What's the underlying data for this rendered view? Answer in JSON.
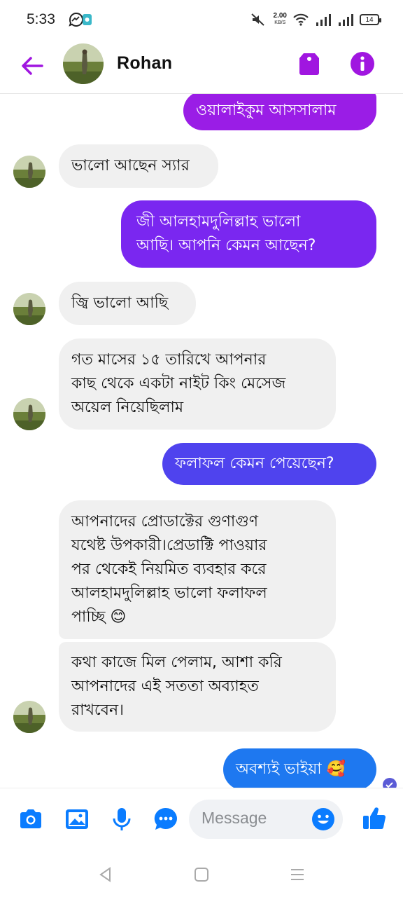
{
  "status_bar": {
    "time": "5:33",
    "net_speed_value": "2.00",
    "net_speed_unit": "KB/S",
    "battery": "14",
    "icons": [
      "messenger-notification-icon",
      "mute-icon",
      "wifi-icon",
      "signal-icon",
      "signal-icon",
      "battery-icon"
    ]
  },
  "header": {
    "contact_name": "Rohan",
    "icons": [
      "back-arrow-icon",
      "avatar",
      "tag-icon",
      "info-icon"
    ]
  },
  "colors": {
    "accent": "#a016e0",
    "bubble_incoming": "#f0f0f0",
    "bubble_out_top": "#9a1de6",
    "bubble_out_mid": "#7a27f0",
    "bubble_out_low": "#4f43ee",
    "bubble_out_bottom": "#1e78f0",
    "composer_icons": "#0a7cff"
  },
  "messages": [
    {
      "side": "out",
      "text": "ওয়ালাইকুম আসসালাম"
    },
    {
      "side": "in",
      "text": "ভালো আছেন স্যার"
    },
    {
      "side": "out",
      "text": "জী আলহামদুলিল্লাহ ভালো\nআছি। আপনি কেমন আছেন?"
    },
    {
      "side": "in",
      "text": "জ্বি ভালো আছি"
    },
    {
      "side": "in",
      "text": "গত মাসের ১৫ তারিখে আপনার\nকাছ থেকে একটা নাইট কিং মেসেজ\nঅয়েল নিয়েছিলাম"
    },
    {
      "side": "out",
      "text": "ফলাফল কেমন পেয়েছেন?"
    },
    {
      "side": "in",
      "text": "আপনাদের প্রোডাক্টের গুণাগুণ\nযথেষ্ট উপকারী।প্রেডাক্টি পাওয়ার\nপর থেকেই নিয়মিত ব্যবহার করে\nআলহামদুলিল্লাহ ভালো ফলাফল\nপাচ্ছি 😊"
    },
    {
      "side": "in",
      "text": "কথা কাজে মিল পেলাম, আশা করি\nআপনাদের এই সততা অব্যাহত\nরাখবেন।"
    },
    {
      "side": "out",
      "text": "অবশ্যই ভাইয়া 🥰"
    }
  ],
  "composer": {
    "placeholder": "Message",
    "icons": [
      "camera-icon",
      "gallery-icon",
      "microphone-icon",
      "chat-options-icon",
      "emoji-icon",
      "thumbs-up-icon"
    ]
  },
  "navbar": {
    "icons": [
      "back-triangle-icon",
      "home-square-icon",
      "menu-lines-icon"
    ]
  }
}
